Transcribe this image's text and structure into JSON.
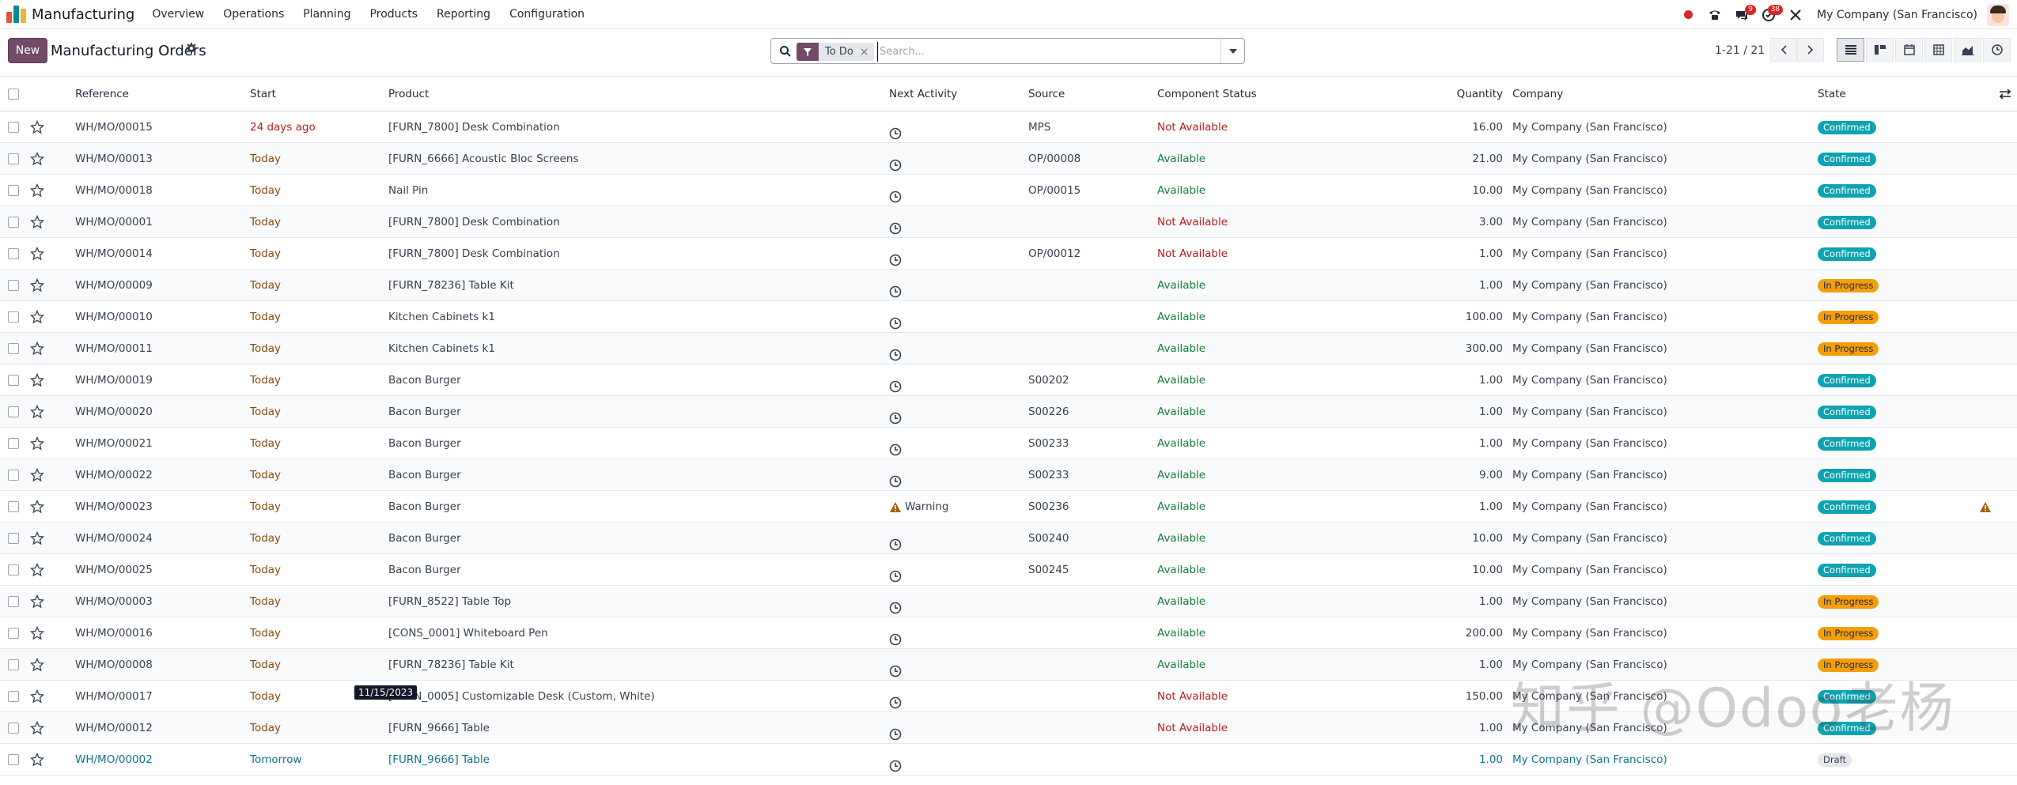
{
  "navbar": {
    "app_name": "Manufacturing",
    "menu": [
      "Overview",
      "Operations",
      "Planning",
      "Products",
      "Reporting",
      "Configuration"
    ],
    "messages_count": "9",
    "activities_count": "38",
    "company": "My Company (San Francisco)"
  },
  "control": {
    "new_label": "New",
    "title": "Manufacturing Orders",
    "facet": "To Do",
    "search_placeholder": "Search...",
    "pager": "1-21 / 21"
  },
  "columns": {
    "reference": "Reference",
    "start": "Start",
    "product": "Product",
    "next_activity": "Next Activity",
    "source": "Source",
    "component_status": "Component Status",
    "quantity": "Quantity",
    "company": "Company",
    "state": "State"
  },
  "rows": [
    {
      "ref": "WH/MO/00015",
      "start": "24 days ago",
      "start_kind": "late",
      "product": "[FURN_7800] Desk Combination",
      "activity": "",
      "source": "MPS",
      "component": "Not Available",
      "qty": "16.00",
      "company": "My Company (San Francisco)",
      "state": "Confirmed"
    },
    {
      "ref": "WH/MO/00013",
      "start": "Today",
      "start_kind": "today",
      "product": "[FURN_6666] Acoustic Bloc Screens",
      "activity": "",
      "source": "OP/00008",
      "component": "Available",
      "qty": "21.00",
      "company": "My Company (San Francisco)",
      "state": "Confirmed"
    },
    {
      "ref": "WH/MO/00018",
      "start": "Today",
      "start_kind": "today",
      "product": "Nail Pin",
      "activity": "",
      "source": "OP/00015",
      "component": "Available",
      "qty": "10.00",
      "company": "My Company (San Francisco)",
      "state": "Confirmed"
    },
    {
      "ref": "WH/MO/00001",
      "start": "Today",
      "start_kind": "today",
      "product": "[FURN_7800] Desk Combination",
      "activity": "",
      "source": "",
      "component": "Not Available",
      "qty": "3.00",
      "company": "My Company (San Francisco)",
      "state": "Confirmed"
    },
    {
      "ref": "WH/MO/00014",
      "start": "Today",
      "start_kind": "today",
      "product": "[FURN_7800] Desk Combination",
      "activity": "",
      "source": "OP/00012",
      "component": "Not Available",
      "qty": "1.00",
      "company": "My Company (San Francisco)",
      "state": "Confirmed"
    },
    {
      "ref": "WH/MO/00009",
      "start": "Today",
      "start_kind": "today",
      "product": "[FURN_78236] Table Kit",
      "activity": "",
      "source": "",
      "component": "Available",
      "qty": "1.00",
      "company": "My Company (San Francisco)",
      "state": "In Progress"
    },
    {
      "ref": "WH/MO/00010",
      "start": "Today",
      "start_kind": "today",
      "product": "Kitchen Cabinets k1",
      "activity": "",
      "source": "",
      "component": "Available",
      "qty": "100.00",
      "company": "My Company (San Francisco)",
      "state": "In Progress"
    },
    {
      "ref": "WH/MO/00011",
      "start": "Today",
      "start_kind": "today",
      "product": "Kitchen Cabinets k1",
      "activity": "",
      "source": "",
      "component": "Available",
      "qty": "300.00",
      "company": "My Company (San Francisco)",
      "state": "In Progress"
    },
    {
      "ref": "WH/MO/00019",
      "start": "Today",
      "start_kind": "today",
      "product": "Bacon Burger",
      "activity": "",
      "source": "S00202",
      "component": "Available",
      "qty": "1.00",
      "company": "My Company (San Francisco)",
      "state": "Confirmed"
    },
    {
      "ref": "WH/MO/00020",
      "start": "Today",
      "start_kind": "today",
      "product": "Bacon Burger",
      "activity": "",
      "source": "S00226",
      "component": "Available",
      "qty": "1.00",
      "company": "My Company (San Francisco)",
      "state": "Confirmed"
    },
    {
      "ref": "WH/MO/00021",
      "start": "Today",
      "start_kind": "today",
      "product": "Bacon Burger",
      "activity": "",
      "source": "S00233",
      "component": "Available",
      "qty": "1.00",
      "company": "My Company (San Francisco)",
      "state": "Confirmed"
    },
    {
      "ref": "WH/MO/00022",
      "start": "Today",
      "start_kind": "today",
      "product": "Bacon Burger",
      "activity": "",
      "source": "S00233",
      "component": "Available",
      "qty": "9.00",
      "company": "My Company (San Francisco)",
      "state": "Confirmed"
    },
    {
      "ref": "WH/MO/00023",
      "start": "Today",
      "start_kind": "today",
      "product": "Bacon Burger",
      "activity": "Warning",
      "source": "S00236",
      "component": "Available",
      "qty": "1.00",
      "company": "My Company (San Francisco)",
      "state": "Confirmed",
      "row_warning": true
    },
    {
      "ref": "WH/MO/00024",
      "start": "Today",
      "start_kind": "today",
      "product": "Bacon Burger",
      "activity": "",
      "source": "S00240",
      "component": "Available",
      "qty": "10.00",
      "company": "My Company (San Francisco)",
      "state": "Confirmed"
    },
    {
      "ref": "WH/MO/00025",
      "start": "Today",
      "start_kind": "today",
      "product": "Bacon Burger",
      "activity": "",
      "source": "S00245",
      "component": "Available",
      "qty": "10.00",
      "company": "My Company (San Francisco)",
      "state": "Confirmed"
    },
    {
      "ref": "WH/MO/00003",
      "start": "Today",
      "start_kind": "today",
      "product": "[FURN_8522] Table Top",
      "activity": "",
      "source": "",
      "component": "Available",
      "qty": "1.00",
      "company": "My Company (San Francisco)",
      "state": "In Progress"
    },
    {
      "ref": "WH/MO/00016",
      "start": "Today",
      "start_kind": "today",
      "product": "[CONS_0001] Whiteboard Pen",
      "activity": "",
      "source": "",
      "component": "Available",
      "qty": "200.00",
      "company": "My Company (San Francisco)",
      "state": "In Progress"
    },
    {
      "ref": "WH/MO/00008",
      "start": "Today",
      "start_kind": "today",
      "product": "[FURN_78236] Table Kit",
      "activity": "",
      "source": "",
      "component": "Available",
      "qty": "1.00",
      "company": "My Company (San Francisco)",
      "state": "In Progress"
    },
    {
      "ref": "WH/MO/00017",
      "start": "Today",
      "start_kind": "today",
      "product": "[FURN_0005] Customizable Desk (Custom, White)",
      "activity": "",
      "source": "",
      "component": "Not Available",
      "qty": "150.00",
      "company": "My Company (San Francisco)",
      "state": "Confirmed"
    },
    {
      "ref": "WH/MO/00012",
      "start": "Today",
      "start_kind": "today",
      "product": "[FURN_9666] Table",
      "activity": "",
      "source": "",
      "component": "Not Available",
      "qty": "1.00",
      "company": "My Company (San Francisco)",
      "state": "Confirmed"
    },
    {
      "ref": "WH/MO/00002",
      "start": "Tomorrow",
      "start_kind": "tomorrow",
      "product": "[FURN_9666] Table",
      "activity": "",
      "source": "",
      "component": "",
      "qty": "1.00",
      "company": "My Company (San Francisco)",
      "state": "Draft",
      "draft": true
    }
  ],
  "tooltip": "11/15/2023",
  "watermark": "知乎 @Odoo老杨",
  "colors": {
    "brand": "#714b67",
    "confirmed": "#0fa3b1",
    "in_progress": "#f59e0b",
    "available": "#15803d",
    "not_available": "#b91c1c"
  }
}
